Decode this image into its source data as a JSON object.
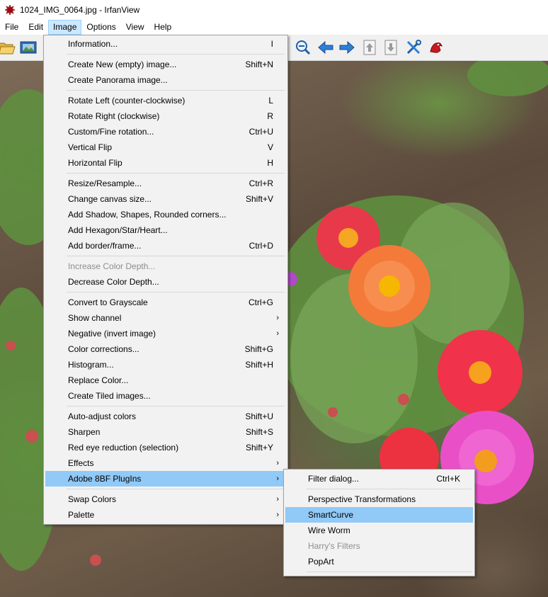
{
  "window": {
    "title": "1024_IMG_0064.jpg - IrfanView"
  },
  "menubar": [
    {
      "label": "File"
    },
    {
      "label": "Edit"
    },
    {
      "label": "Image"
    },
    {
      "label": "Options"
    },
    {
      "label": "View"
    },
    {
      "label": "Help"
    }
  ],
  "toolbar": {
    "left_icons": [
      "open-folder-icon",
      "slideshow-icon"
    ],
    "right_icons": [
      "zoom-out-icon",
      "back-arrow-icon",
      "forward-arrow-icon",
      "page-up-icon",
      "page-down-icon",
      "tools-icon",
      "irfanview-logo-icon"
    ]
  },
  "image_menu": {
    "items": [
      {
        "label": "Information...",
        "shortcut": "I"
      },
      {
        "label": "Create New (empty) image...",
        "shortcut": "Shift+N"
      },
      {
        "label": "Create Panorama image...",
        "shortcut": ""
      },
      {
        "label": "Rotate Left (counter-clockwise)",
        "shortcut": "L"
      },
      {
        "label": "Rotate Right (clockwise)",
        "shortcut": "R"
      },
      {
        "label": "Custom/Fine rotation...",
        "shortcut": "Ctrl+U"
      },
      {
        "label": "Vertical Flip",
        "shortcut": "V"
      },
      {
        "label": "Horizontal Flip",
        "shortcut": "H"
      },
      {
        "label": "Resize/Resample...",
        "shortcut": "Ctrl+R"
      },
      {
        "label": "Change canvas size...",
        "shortcut": "Shift+V"
      },
      {
        "label": "Add Shadow, Shapes, Rounded corners...",
        "shortcut": ""
      },
      {
        "label": "Add Hexagon/Star/Heart...",
        "shortcut": ""
      },
      {
        "label": "Add border/frame...",
        "shortcut": "Ctrl+D"
      },
      {
        "label": "Increase Color Depth...",
        "shortcut": "",
        "disabled": true
      },
      {
        "label": "Decrease Color Depth...",
        "shortcut": ""
      },
      {
        "label": "Convert to Grayscale",
        "shortcut": "Ctrl+G"
      },
      {
        "label": "Show channel",
        "shortcut": "",
        "submenu": true
      },
      {
        "label": "Negative (invert image)",
        "shortcut": "",
        "submenu": true
      },
      {
        "label": "Color corrections...",
        "shortcut": "Shift+G"
      },
      {
        "label": "Histogram...",
        "shortcut": "Shift+H"
      },
      {
        "label": "Replace Color...",
        "shortcut": ""
      },
      {
        "label": "Create Tiled images...",
        "shortcut": ""
      },
      {
        "label": "Auto-adjust colors",
        "shortcut": "Shift+U"
      },
      {
        "label": "Sharpen",
        "shortcut": "Shift+S"
      },
      {
        "label": "Red eye reduction (selection)",
        "shortcut": "Shift+Y"
      },
      {
        "label": "Effects",
        "shortcut": "",
        "submenu": true
      },
      {
        "label": "Adobe 8BF PlugIns",
        "shortcut": "",
        "submenu": true,
        "highlighted": true
      },
      {
        "label": "Swap Colors",
        "shortcut": "",
        "submenu": true
      },
      {
        "label": "Palette",
        "shortcut": "",
        "submenu": true
      }
    ]
  },
  "plugins_menu": {
    "items": [
      {
        "label": "Filter dialog...",
        "shortcut": "Ctrl+K"
      },
      {
        "label": "Perspective Transformations",
        "shortcut": ""
      },
      {
        "label": "SmartCurve",
        "shortcut": "",
        "highlighted": true
      },
      {
        "label": "Wire Worm",
        "shortcut": ""
      },
      {
        "label": "Harry's Filters",
        "shortcut": "",
        "disabled": true
      },
      {
        "label": "PopArt",
        "shortcut": ""
      }
    ]
  },
  "colors": {
    "menu_highlight": "#91c9f7",
    "active_menubar": "#cce8ff"
  }
}
